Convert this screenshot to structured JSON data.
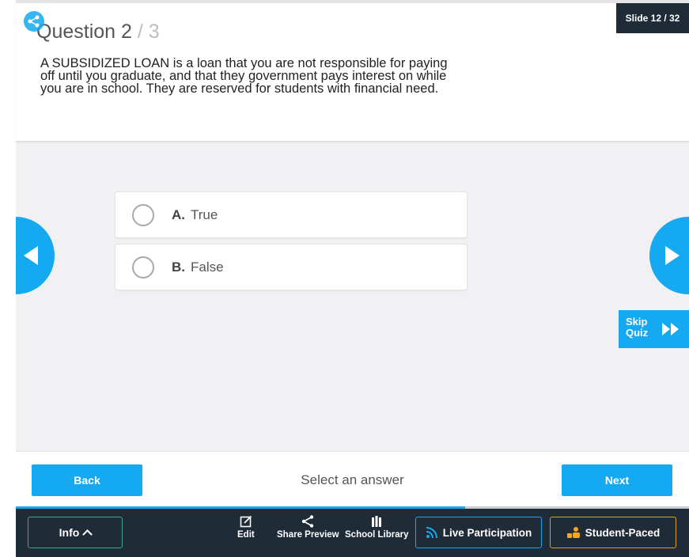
{
  "question": {
    "label": "Question 2",
    "separator": "/",
    "total": "3",
    "text": "A SUBSIDIZED LOAN is a loan that you are not responsible for paying off until you graduate, and that they government pays interest on while you are in school. They are reserved for students with financial need."
  },
  "slide_badge": "Slide 12 / 32",
  "options": [
    {
      "letter": "A.",
      "text": "True"
    },
    {
      "letter": "B.",
      "text": "False"
    }
  ],
  "skip": {
    "line1": "Skip",
    "line2": "Quiz"
  },
  "footer": {
    "back_label": "Back",
    "hint": "Select an answer",
    "next_label": "Next"
  },
  "progress": {
    "fraction": 0.667
  },
  "toolbar": {
    "info_label": "Info",
    "edit_label": "Edit",
    "share_label": "Share Preview",
    "library_label": "School Library",
    "live_label": "Live Participation",
    "student_label": "Student-Paced"
  },
  "colors": {
    "accent": "#15a9f2",
    "dark_bar": "#1f2b36",
    "info_border": "#3fa58e",
    "student_border": "#d9a21a",
    "student_icon": "#f5a623"
  },
  "icons": {
    "share": "share-icon",
    "edit": "edit-icon",
    "library": "library-icon",
    "live": "live-icon",
    "student": "student-icon"
  }
}
